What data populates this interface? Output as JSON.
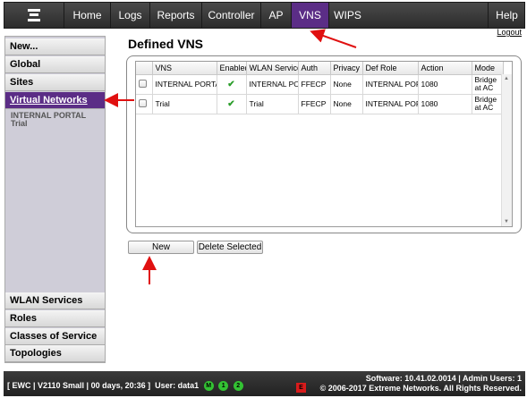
{
  "nav": {
    "tabs": [
      "Home",
      "Logs",
      "Reports",
      "Controller",
      "AP",
      "VNS",
      "WIPS"
    ],
    "active_tab": "VNS",
    "help": "Help",
    "logout": "Logout",
    "accent_color": "#5b2d86"
  },
  "sidebar": {
    "top_items": [
      "New...",
      "Global",
      "Sites",
      "Virtual Networks"
    ],
    "active_item": "Virtual Networks",
    "sub_items": [
      "INTERNAL PORTAL",
      "Trial"
    ],
    "bottom_items": [
      "WLAN Services",
      "Roles",
      "Classes of Service",
      "Topologies"
    ]
  },
  "main": {
    "title": "Defined VNS",
    "table": {
      "columns": [
        "VNS",
        "Enabled",
        "WLAN Service",
        "Auth",
        "Privacy",
        "Def Role",
        "Action",
        "Mode"
      ],
      "rows": [
        {
          "vns": "INTERNAL PORTAL",
          "enabled": "✔",
          "wlan": "INTERNAL PORTAL",
          "auth": "FFECP",
          "privacy": "None",
          "role": "INTERNAL PORTAL",
          "action": "1080",
          "mode": "Bridge at AC"
        },
        {
          "vns": "Trial",
          "enabled": "✔",
          "wlan": "Trial",
          "auth": "FFECP",
          "privacy": "None",
          "role": "INTERNAL PORTAL",
          "action": "1080",
          "mode": "Bridge at AC"
        }
      ]
    },
    "buttons": {
      "new": "New",
      "delete": "Delete Selected"
    }
  },
  "status": {
    "left": "[ EWC | V2110 Small | 00 days, 20:36 ]",
    "user": "User: data1",
    "indicators": [
      "M",
      "1",
      "2"
    ],
    "alarm": "E",
    "software": "Software: 10.41.02.0014 | Admin Users: 1",
    "copyright": "© 2006-2017 Extreme Networks. All Rights Reserved."
  }
}
